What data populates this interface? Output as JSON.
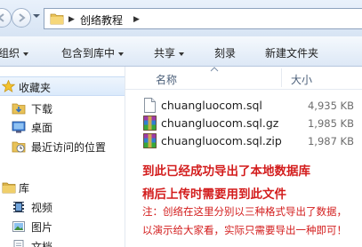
{
  "address": {
    "crumb": "创络教程"
  },
  "toolbar": {
    "organize": "组织",
    "include_library": "包含到库中",
    "share": "共享",
    "burn": "刻录",
    "new_folder": "新建文件夹"
  },
  "nav": {
    "favorites": "收藏夹",
    "downloads": "下载",
    "desktop": "桌面",
    "recent": "最近访问的位置",
    "libraries": "库",
    "videos": "视频",
    "pictures": "图片",
    "documents": "文档"
  },
  "columns": {
    "name": "名称",
    "size": "大小"
  },
  "files": [
    {
      "name": "chuangluocom.sql",
      "size": "4,935 KB",
      "icon": "sql-file-icon"
    },
    {
      "name": "chuangluocom.sql.gz",
      "size": "1,985 KB",
      "icon": "archive-icon"
    },
    {
      "name": "chuangluocom.sql.zip",
      "size": "1,987 KB",
      "icon": "archive-icon"
    }
  ],
  "notes": {
    "line1": "到此已经成功导出了本地数据库",
    "line2": "稍后上传时需要用到此文件",
    "line3": "注：创络在这里分别以三种格式导出了数据，",
    "line4": "以演示给大家看，实际只需要导出一种即可！"
  },
  "colors": {
    "annotation_red": "#d31d1d",
    "toolbar_bg": "#dde8f6"
  }
}
